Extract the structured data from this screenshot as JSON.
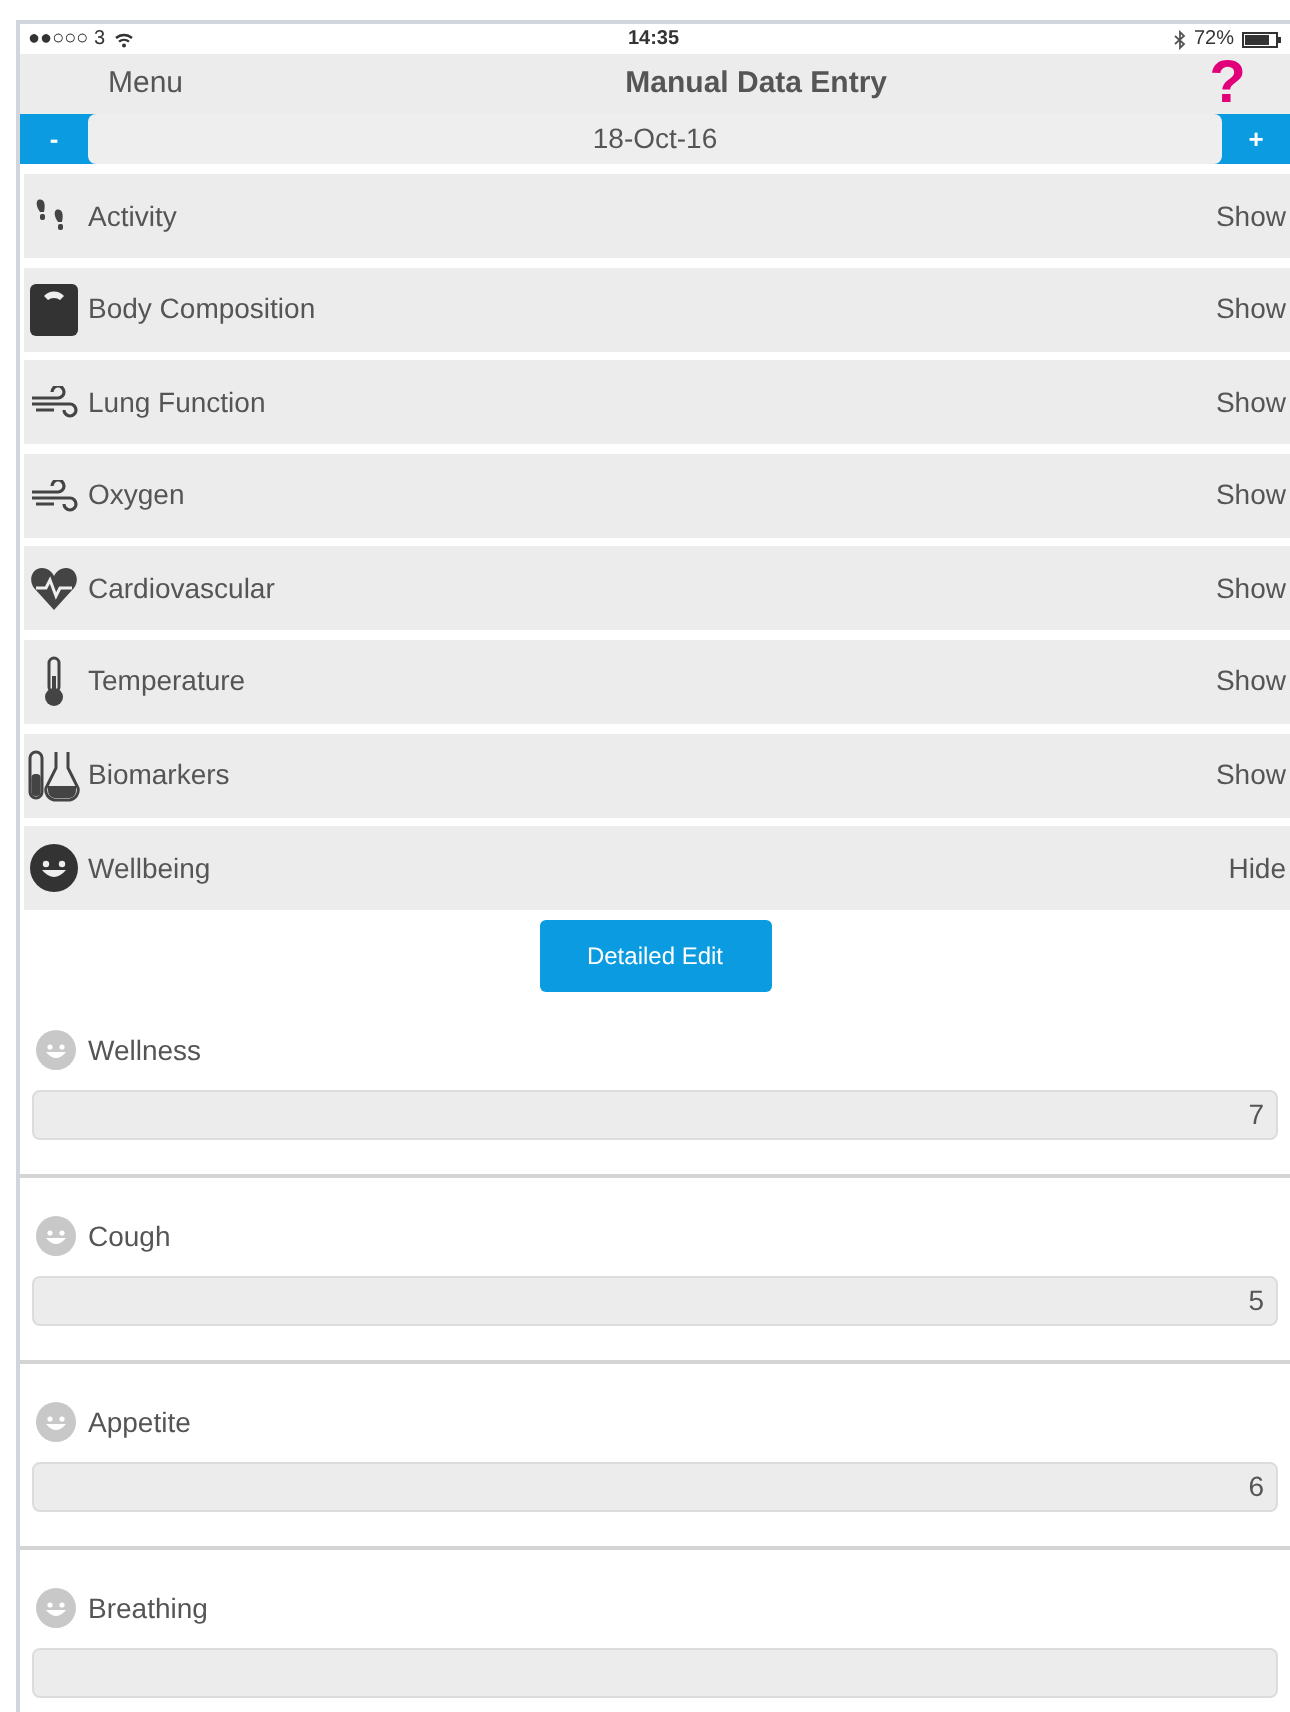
{
  "status_bar": {
    "carrier": "●●○○○ 3",
    "time": "14:35",
    "battery": "72%"
  },
  "nav": {
    "menu": "Menu",
    "title": "Manual Data Entry",
    "help": "?"
  },
  "date_bar": {
    "minus": "-",
    "date": "18-Oct-16",
    "plus": "+"
  },
  "categories": [
    {
      "kind": "activity",
      "label": "Activity",
      "action": "Show"
    },
    {
      "kind": "scale",
      "label": "Body Composition",
      "action": "Show"
    },
    {
      "kind": "wind",
      "label": "Lung Function",
      "action": "Show"
    },
    {
      "kind": "wind",
      "label": "Oxygen",
      "action": "Show"
    },
    {
      "kind": "heart",
      "label": "Cardiovascular",
      "action": "Show"
    },
    {
      "kind": "thermometer",
      "label": "Temperature",
      "action": "Show"
    },
    {
      "kind": "flask",
      "label": "Biomarkers",
      "action": "Show"
    },
    {
      "kind": "smiley",
      "label": "Wellbeing",
      "action": "Hide"
    }
  ],
  "detail_button": "Detailed Edit",
  "metrics": [
    {
      "label": "Wellness",
      "value": "7"
    },
    {
      "label": "Cough",
      "value": "5"
    },
    {
      "label": "Appetite",
      "value": "6"
    },
    {
      "label": "Breathing"
    }
  ]
}
